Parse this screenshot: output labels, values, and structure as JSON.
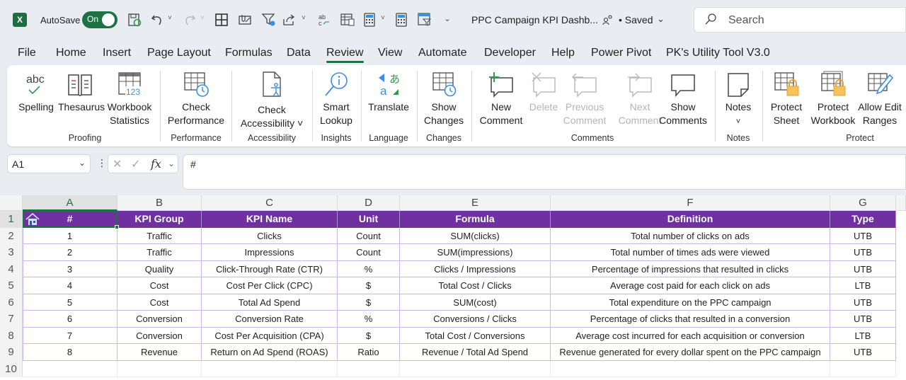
{
  "titlebar": {
    "app_icon": "excel-logo-icon",
    "app_letter": "X",
    "autosave_label": "AutoSave",
    "autosave_state": "On",
    "document_title": "PPC Campaign KPI Dashb...",
    "save_status": "• Saved",
    "search_placeholder": "Search",
    "quick_access_icons": [
      "save-sync-icon",
      "undo-icon",
      "redo-icon",
      "borders-icon",
      "attach-email-icon",
      "filter-icon",
      "share-icon",
      "spelling-icon",
      "form-icon",
      "calculator-icon",
      "calculator-icon",
      "filter-view-icon",
      "customize-icon"
    ]
  },
  "tabs": [
    "File",
    "Home",
    "Insert",
    "Page Layout",
    "Formulas",
    "Data",
    "Review",
    "View",
    "Automate",
    "Developer",
    "Help",
    "Power Pivot",
    "PK's Utility Tool V3.0"
  ],
  "active_tab": "Review",
  "ribbon": {
    "groups": [
      {
        "label": "Proofing",
        "buttons": [
          {
            "line1": "Spelling",
            "line2": ""
          },
          {
            "line1": "Thesaurus",
            "line2": ""
          },
          {
            "line1": "Workbook",
            "line2": "Statistics"
          }
        ]
      },
      {
        "label": "Performance",
        "buttons": [
          {
            "line1": "Check",
            "line2": "Performance"
          }
        ]
      },
      {
        "label": "Accessibility",
        "buttons": [
          {
            "line1": "Check",
            "line2": "Accessibility ˅"
          }
        ]
      },
      {
        "label": "Insights",
        "buttons": [
          {
            "line1": "Smart",
            "line2": "Lookup"
          }
        ]
      },
      {
        "label": "Language",
        "buttons": [
          {
            "line1": "Translate",
            "line2": ""
          }
        ]
      },
      {
        "label": "Changes",
        "buttons": [
          {
            "line1": "Show",
            "line2": "Changes"
          }
        ]
      },
      {
        "label": "Comments",
        "buttons": [
          {
            "line1": "New",
            "line2": "Comment"
          },
          {
            "line1": "Delete",
            "line2": ""
          },
          {
            "line1": "Previous",
            "line2": "Comment"
          },
          {
            "line1": "Next",
            "line2": "Comment"
          },
          {
            "line1": "Show",
            "line2": "Comments"
          }
        ]
      },
      {
        "label": "Notes",
        "buttons": [
          {
            "line1": "Notes",
            "line2": "˅"
          }
        ]
      },
      {
        "label": "Protect",
        "buttons": [
          {
            "line1": "Protect",
            "line2": "Sheet"
          },
          {
            "line1": "Protect",
            "line2": "Workbook"
          },
          {
            "line1": "Allow Edit",
            "line2": "Ranges"
          }
        ]
      }
    ]
  },
  "formula_bar": {
    "name_box": "A1",
    "fx_label": "fx",
    "formula_value": "#"
  },
  "sheet": {
    "columns": [
      "A",
      "B",
      "C",
      "D",
      "E",
      "F",
      "G"
    ],
    "rows": [
      "1",
      "2",
      "3",
      "4",
      "5",
      "6",
      "7",
      "8",
      "9",
      "10"
    ],
    "header": [
      "#",
      "KPI Group",
      "KPI Name",
      "Unit",
      "Formula",
      "Definition",
      "Type"
    ],
    "data": [
      [
        "1",
        "Traffic",
        "Clicks",
        "Count",
        "SUM(clicks)",
        "Total number of clicks on ads",
        "UTB"
      ],
      [
        "2",
        "Traffic",
        "Impressions",
        "Count",
        "SUM(impressions)",
        "Total number of times ads were viewed",
        "UTB"
      ],
      [
        "3",
        "Quality",
        "Click-Through Rate (CTR)",
        "%",
        "Clicks / Impressions",
        "Percentage of impressions that resulted in clicks",
        "UTB"
      ],
      [
        "4",
        "Cost",
        "Cost Per Click (CPC)",
        "$",
        "Total Cost / Clicks",
        "Average cost paid for each click on ads",
        "LTB"
      ],
      [
        "5",
        "Cost",
        "Total Ad Spend",
        "$",
        "SUM(cost)",
        "Total expenditure on the PPC campaign",
        "UTB"
      ],
      [
        "6",
        "Conversion",
        "Conversion Rate",
        "%",
        "Conversions / Clicks",
        "Percentage of clicks that resulted in a conversion",
        "UTB"
      ],
      [
        "7",
        "Conversion",
        "Cost Per Acquisition (CPA)",
        "$",
        "Total Cost / Conversions",
        "Average cost incurred for each acquisition or conversion",
        "LTB"
      ],
      [
        "8",
        "Revenue",
        "Return on Ad Spend (ROAS)",
        "Ratio",
        "Revenue / Total Ad Spend",
        "Revenue generated for every dollar spent on the PPC campaign",
        "UTB"
      ]
    ],
    "selected_cell": "A1",
    "colors": {
      "header_bg": "#7030a0",
      "header_text": "#ffffff",
      "border": "#c6b9ea",
      "accent": "#1e7145"
    }
  }
}
